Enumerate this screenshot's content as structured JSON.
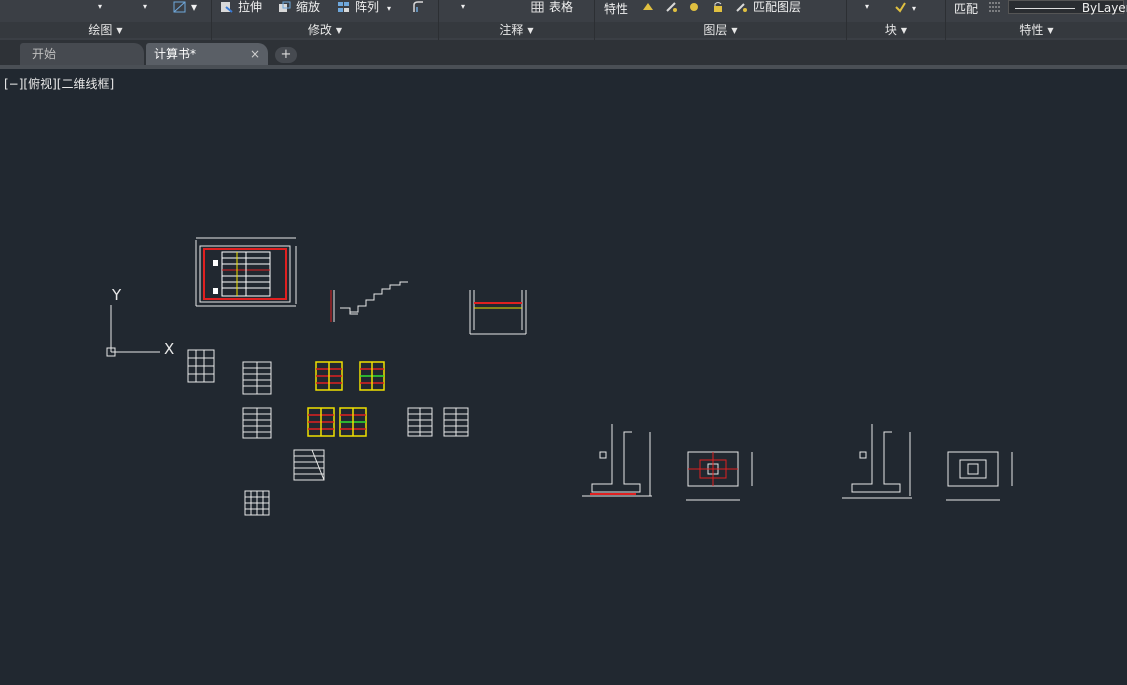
{
  "ribbon": {
    "panels": [
      {
        "title": "绘图"
      },
      {
        "title": "修改"
      },
      {
        "title": "注释"
      },
      {
        "title": "图层"
      },
      {
        "title": "块"
      },
      {
        "title": "特性"
      }
    ],
    "tools": {
      "stretch": "拉伸",
      "scale": "缩放",
      "array": "阵列",
      "table": "表格",
      "layer_props": "特性",
      "match_layer": "匹配图层",
      "match_props": "匹配",
      "linetype": "ByLayer"
    }
  },
  "tabs": [
    {
      "label": "开始",
      "active": false
    },
    {
      "label": "计算书*",
      "active": true
    }
  ],
  "tab_add": "+",
  "tab_close": "×",
  "viewport": {
    "label": "[−][俯视][二维线框]"
  },
  "ucs": {
    "x_label": "X",
    "y_label": "Y"
  },
  "colors": {
    "background": "#212830",
    "ribbon": "#3b3f45",
    "accent_red": "#e02020",
    "accent_yellow": "#f0e000",
    "accent_green": "#30e030"
  }
}
